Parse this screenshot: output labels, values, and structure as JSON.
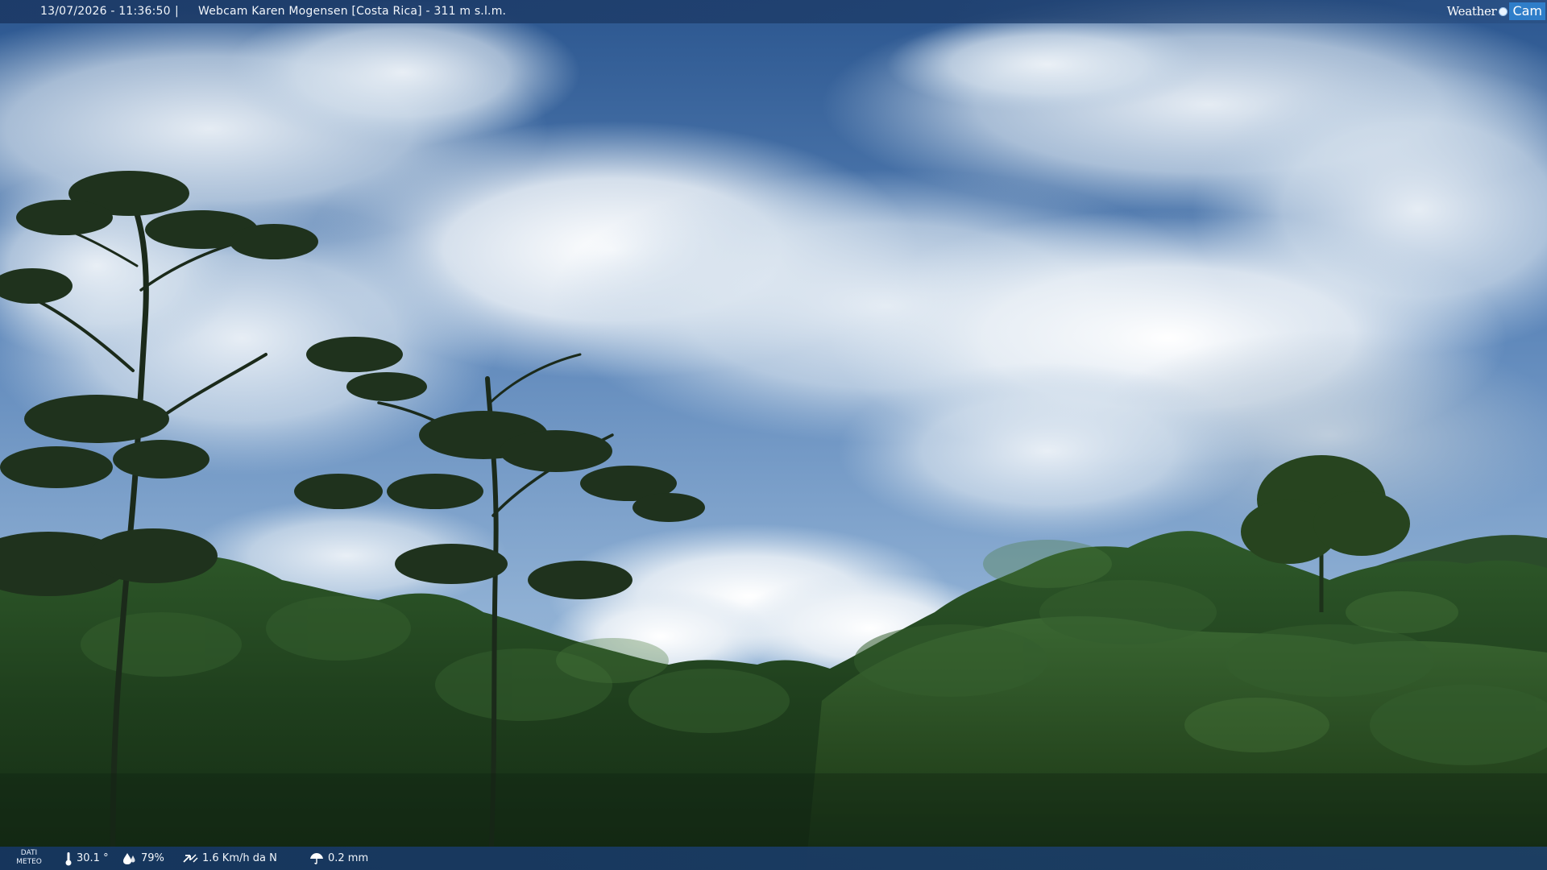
{
  "header": {
    "timestamp": "13/07/2026 - 11:36:50",
    "separator": "|",
    "title": "Webcam Karen Mogensen [Costa Rica] - 311 m s.l.m.",
    "brand_weather": "Weather",
    "brand_cam": "Cam"
  },
  "footer": {
    "label_line1": "DATI",
    "label_line2": "METEO",
    "temperature": "30.1 °",
    "humidity": "79%",
    "wind": "1.6 Km/h da N",
    "rain": "0.2 mm"
  },
  "icons": {
    "temperature": "thermometer-icon",
    "humidity": "humidity-drop-icon",
    "wind": "wind-icon",
    "rain": "rain-umbrella-icon"
  },
  "colors": {
    "bar": "#1c3a66",
    "sky_top": "#2d5a94",
    "foliage": "#1f3d1e",
    "brand_accent": "#2f7ec9"
  }
}
